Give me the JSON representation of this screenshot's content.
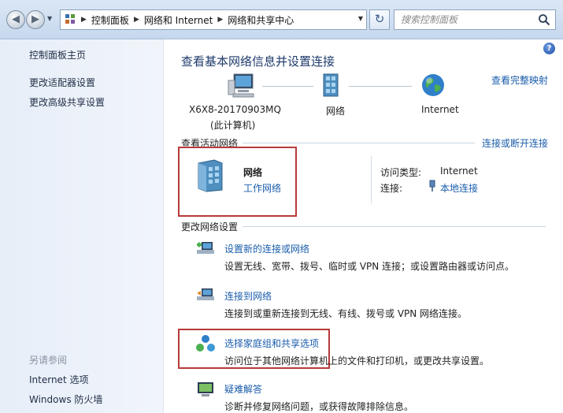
{
  "address_bar": {
    "breadcrumbs": [
      "控制面板",
      "网络和 Internet",
      "网络和共享中心"
    ]
  },
  "search": {
    "placeholder": "搜索控制面板"
  },
  "sidebar": {
    "home": "控制面板主页",
    "links": [
      "更改适配器设置",
      "更改高级共享设置"
    ],
    "see_also_heading": "另请参阅",
    "see_also": [
      "Internet 选项",
      "Windows 防火墙"
    ]
  },
  "main": {
    "title": "查看基本网络信息并设置连接",
    "view_full_map": "查看完整映射",
    "map": {
      "computer_name": "X6X8-20170903MQ",
      "computer_note": "(此计算机)",
      "network": "网络",
      "internet": "Internet"
    },
    "active_networks": {
      "heading": "查看活动网络",
      "connect_disconnect": "连接或断开连接",
      "network_name": "网络",
      "network_type": "工作网络",
      "access_type_label": "访问类型:",
      "access_type_value": "Internet",
      "connections_label": "连接:",
      "connections_value": "本地连接"
    },
    "change_settings": {
      "heading": "更改网络设置",
      "items": [
        {
          "title": "设置新的连接或网络",
          "desc": "设置无线、宽带、拨号、临时或 VPN 连接；或设置路由器或访问点。"
        },
        {
          "title": "连接到网络",
          "desc": "连接到或重新连接到无线、有线、拨号或 VPN 网络连接。"
        },
        {
          "title": "选择家庭组和共享选项",
          "desc": "访问位于其他网络计算机上的文件和打印机，或更改共享设置。"
        },
        {
          "title": "疑难解答",
          "desc": "诊断并修复网络问题，或获得故障排除信息。"
        }
      ]
    }
  },
  "colors": {
    "link": "#1a5dab",
    "title": "#1e3a6c",
    "highlight_box": "#b83a3a"
  }
}
